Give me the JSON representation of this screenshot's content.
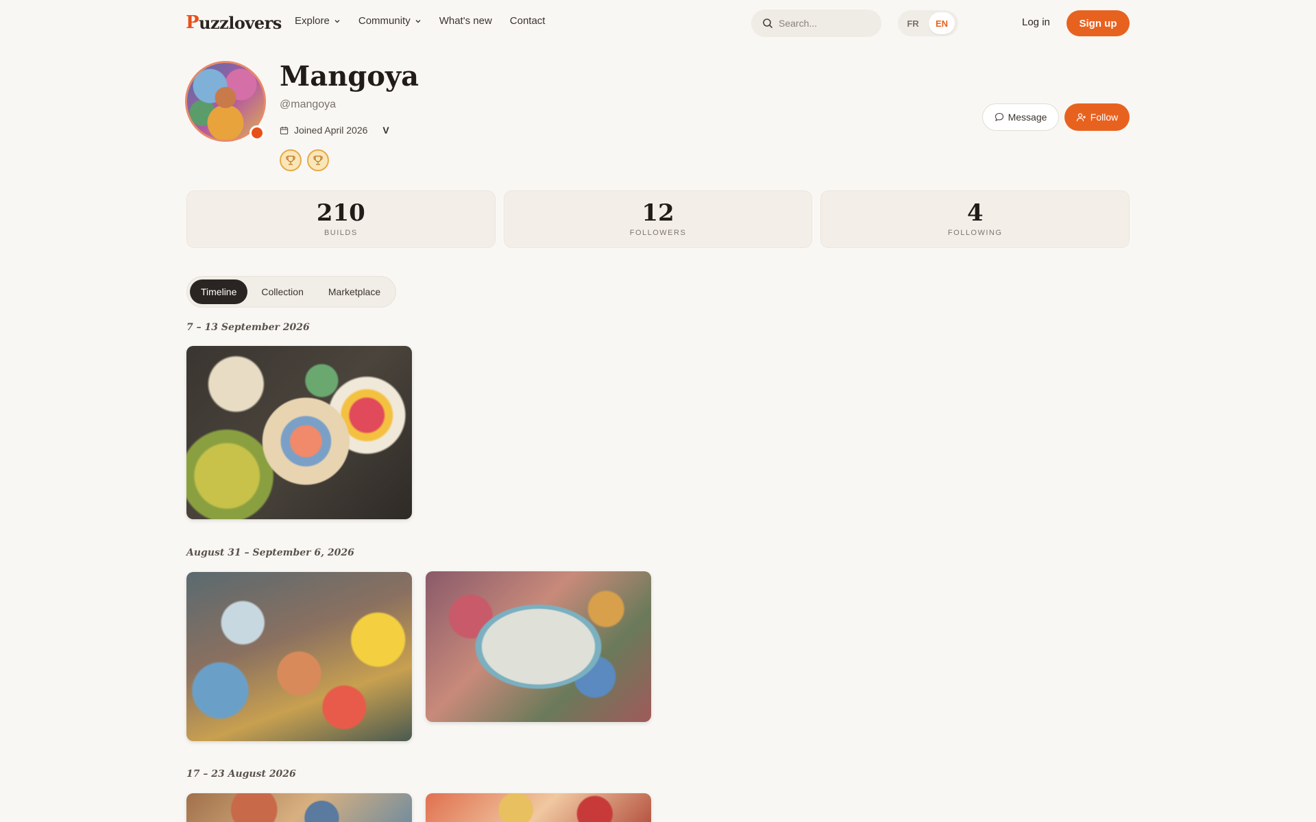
{
  "header": {
    "logo_text": "uzzlovers",
    "logo_mark": "P",
    "nav": [
      {
        "label": "Explore",
        "has_dropdown": true
      },
      {
        "label": "Community",
        "has_dropdown": true
      },
      {
        "label": "What's new",
        "has_dropdown": false
      },
      {
        "label": "Contact",
        "has_dropdown": false
      }
    ],
    "search_placeholder": "Search...",
    "lang_fr": "FR",
    "lang_en": "EN",
    "login_label": "Log in",
    "signup_label": "Sign up"
  },
  "profile": {
    "name": "Mangoya",
    "handle": "@mangoya",
    "joined": "Joined April 2026",
    "verified_mark": "V",
    "message_label": "Message",
    "follow_label": "Follow"
  },
  "stats": [
    {
      "value": "210",
      "label": "BUILDS"
    },
    {
      "value": "12",
      "label": "FOLLOWERS"
    },
    {
      "value": "4",
      "label": "FOLLOWING"
    }
  ],
  "tabs": [
    {
      "label": "Timeline",
      "active": true
    },
    {
      "label": "Collection",
      "active": false
    },
    {
      "label": "Marketplace",
      "active": false
    }
  ],
  "timeline": [
    {
      "week": "7 – 13 September 2026"
    },
    {
      "week": "August 31 – September 6, 2026"
    },
    {
      "week": "17 – 23 August 2026"
    }
  ],
  "colors": {
    "accent": "#e8621f",
    "background": "#f9f7f4",
    "dark": "#2a2522"
  }
}
